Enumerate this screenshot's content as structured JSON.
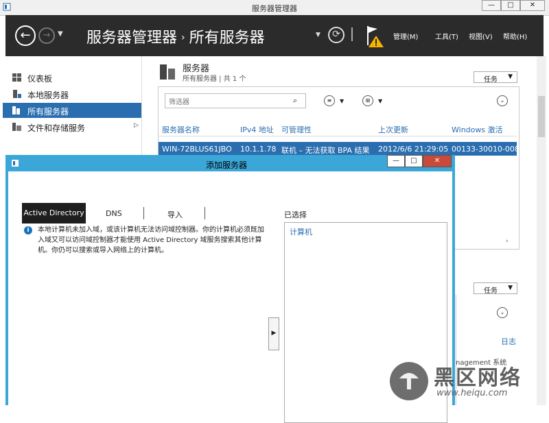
{
  "window": {
    "title": "服务器管理器",
    "minimize": "—",
    "maximize": "□",
    "close": "✕"
  },
  "header": {
    "breadcrumb_root": "服务器管理器",
    "breadcrumb_sep": "›",
    "breadcrumb_current": "所有服务器",
    "menu": [
      "管理(M)",
      "工具(T)",
      "视图(V)",
      "帮助(H)"
    ]
  },
  "sidebar": {
    "items": [
      {
        "label": "仪表板",
        "icon": "dashboard-icon"
      },
      {
        "label": "本地服务器",
        "icon": "server-icon"
      },
      {
        "label": "所有服务器",
        "icon": "servers-icon",
        "active": true
      },
      {
        "label": "文件和存储服务",
        "icon": "storage-icon",
        "chevron": "▷"
      }
    ]
  },
  "servers_tile": {
    "title": "服务器",
    "subtitle": "所有服务器 | 共 1 个",
    "tasks_label": "任务",
    "filter_placeholder": "筛选器",
    "columns": [
      "服务器名称",
      "IPv4 地址",
      "可管理性",
      "上次更新",
      "Windows 激活"
    ],
    "rows": [
      [
        "WIN-72BLUS61JBO",
        "10.1.1.78",
        "联机 – 无法获取 BPA 结果",
        "2012/6/6 21:29:05",
        "00133-30010-008"
      ]
    ],
    "scroll_right": "›"
  },
  "events_tile": {
    "tasks_label": "任务",
    "link": "日志",
    "row_fragment": "nagement  系统"
  },
  "dialog": {
    "title": "添加服务器",
    "tabs": [
      "Active Directory",
      "DNS",
      "导入"
    ],
    "info": "本地计算机未加入域，或该计算机无法访问域控制器。你的计算机必须既加入域又可以访问域控制器才能使用 Active Directory 域服务搜索其他计算机。你仍可以搜索或导入网络上的计算机。",
    "selected_label": "已选择",
    "selected_column": "计算机",
    "add_arrow": "▶"
  },
  "watermark": {
    "brand": "黑区网络",
    "url": "www.heiqu.com"
  },
  "colors": {
    "header_bg": "#2b2b2b",
    "accent": "#2a6eb0",
    "dialog_border": "#3ba7d8"
  }
}
